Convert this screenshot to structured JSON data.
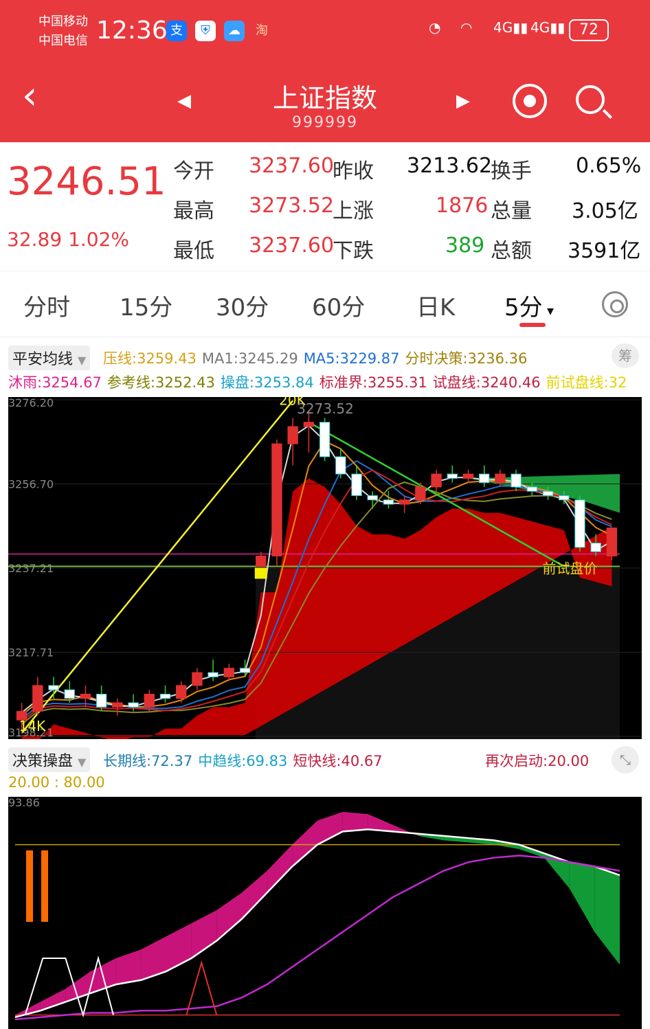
{
  "status_bar": {
    "carrier1": "中国移动",
    "carrier2": "中国电信",
    "time": "12:36",
    "app_icons": [
      "alipay-icon",
      "shield-icon",
      "weather-icon",
      "taobao-icon"
    ],
    "taobao_label": "淘",
    "alipay_label": "支",
    "signal_label": "4G",
    "battery": "72"
  },
  "header": {
    "title": "上证指数",
    "code": "999999"
  },
  "quote": {
    "price": "3246.51",
    "change": "32.89",
    "change_pct": "1.02%",
    "rows": [
      [
        {
          "label": "今开",
          "value": "3237.60"
        },
        {
          "label": "昨收",
          "value": "3213.62"
        },
        {
          "label": "换手",
          "value": "0.65%"
        }
      ],
      [
        {
          "label": "最高",
          "value": "3273.52"
        },
        {
          "label": "上涨",
          "value": "1876"
        },
        {
          "label": "总量",
          "value": "3.05亿"
        }
      ],
      [
        {
          "label": "最低",
          "value": "3237.60"
        },
        {
          "label": "下跌",
          "value": "389"
        },
        {
          "label": "总额",
          "value": "3591亿"
        }
      ]
    ]
  },
  "tabs": [
    "分时",
    "15分",
    "30分",
    "60分",
    "日K",
    "5分"
  ],
  "active_tab": "5分",
  "main_indicator": {
    "name": "平安均线",
    "line1": [
      {
        "label": "压线:",
        "value": "3259.43",
        "color": "#d4a017"
      },
      {
        "label": "MA1:",
        "value": "3245.29",
        "color": "#777777"
      },
      {
        "label": "MA5:",
        "value": "3229.87",
        "color": "#1f6fcf"
      },
      {
        "label": "分时决策:",
        "value": "3236.36",
        "color": "#a0820a"
      }
    ],
    "line2": [
      {
        "label": "沐雨:",
        "value": "3254.67",
        "color": "#e0208c"
      },
      {
        "label": "参考线:",
        "value": "3252.43",
        "color": "#808000"
      },
      {
        "label": "操盘:",
        "value": "3253.84",
        "color": "#1aa0c8"
      },
      {
        "label": "标准界:",
        "value": "3255.31",
        "color": "#c02040"
      },
      {
        "label": "试盘线:",
        "value": "3240.46",
        "color": "#c02040"
      },
      {
        "label": "前试盘线:",
        "value": "32",
        "color": "#e6d200"
      }
    ],
    "chip_label": "筹"
  },
  "sub_indicator": {
    "name": "决策操盘",
    "items": [
      {
        "label": "长期线:",
        "value": "72.37",
        "color": "#1f7fb0"
      },
      {
        "label": "中趋线:",
        "value": "69.83",
        "color": "#1aa0c8"
      },
      {
        "label": "短快线:",
        "value": "40.67",
        "color": "#c02040"
      }
    ],
    "restart": {
      "label": "再次启动:",
      "value": "20.00",
      "color": "#c02040"
    },
    "levels": "20.00 : 80.00",
    "levels_color": "#c8a000"
  },
  "chart_data": [
    {
      "type": "candlestick",
      "title": "",
      "y_ticks": [
        "3276.20",
        "3256.70",
        "3237.21",
        "3217.71",
        "3198.21"
      ],
      "ylim": [
        3198.21,
        3276.2
      ],
      "annotations": [
        "20K",
        "3273.52",
        "14K",
        "前试盘价"
      ],
      "candles": [
        {
          "o": 3202,
          "h": 3206,
          "l": 3199,
          "c": 3204
        },
        {
          "o": 3204,
          "h": 3212,
          "l": 3203,
          "c": 3210
        },
        {
          "o": 3210,
          "h": 3212,
          "l": 3207,
          "c": 3209
        },
        {
          "o": 3209,
          "h": 3211,
          "l": 3206,
          "c": 3207
        },
        {
          "o": 3207,
          "h": 3210,
          "l": 3205,
          "c": 3208
        },
        {
          "o": 3208,
          "h": 3210,
          "l": 3204,
          "c": 3205
        },
        {
          "o": 3205,
          "h": 3207,
          "l": 3203,
          "c": 3206
        },
        {
          "o": 3206,
          "h": 3208,
          "l": 3204,
          "c": 3205
        },
        {
          "o": 3205,
          "h": 3209,
          "l": 3204,
          "c": 3208
        },
        {
          "o": 3208,
          "h": 3210,
          "l": 3206,
          "c": 3207
        },
        {
          "o": 3207,
          "h": 3211,
          "l": 3206,
          "c": 3210
        },
        {
          "o": 3210,
          "h": 3214,
          "l": 3209,
          "c": 3213
        },
        {
          "o": 3213,
          "h": 3216,
          "l": 3211,
          "c": 3212
        },
        {
          "o": 3212,
          "h": 3215,
          "l": 3211,
          "c": 3214
        },
        {
          "o": 3214,
          "h": 3216,
          "l": 3212,
          "c": 3213
        },
        {
          "o": 3237.6,
          "h": 3241,
          "l": 3237.6,
          "c": 3240
        },
        {
          "o": 3240,
          "h": 3267,
          "l": 3237.6,
          "c": 3266
        },
        {
          "o": 3266,
          "h": 3272,
          "l": 3261,
          "c": 3270
        },
        {
          "o": 3270,
          "h": 3273.52,
          "l": 3264,
          "c": 3271
        },
        {
          "o": 3271,
          "h": 3272,
          "l": 3262,
          "c": 3263
        },
        {
          "o": 3263,
          "h": 3265,
          "l": 3258,
          "c": 3259
        },
        {
          "o": 3259,
          "h": 3261,
          "l": 3253,
          "c": 3254
        },
        {
          "o": 3254,
          "h": 3255,
          "l": 3251,
          "c": 3253
        },
        {
          "o": 3253,
          "h": 3255,
          "l": 3251,
          "c": 3252
        },
        {
          "o": 3252,
          "h": 3254,
          "l": 3250,
          "c": 3253
        },
        {
          "o": 3253,
          "h": 3257,
          "l": 3252,
          "c": 3256
        },
        {
          "o": 3256,
          "h": 3260,
          "l": 3255,
          "c": 3259
        },
        {
          "o": 3259,
          "h": 3261,
          "l": 3257,
          "c": 3258
        },
        {
          "o": 3258,
          "h": 3260,
          "l": 3257,
          "c": 3259
        },
        {
          "o": 3259,
          "h": 3261,
          "l": 3256,
          "c": 3257
        },
        {
          "o": 3257,
          "h": 3260,
          "l": 3256,
          "c": 3259
        },
        {
          "o": 3259,
          "h": 3260,
          "l": 3255,
          "c": 3256
        },
        {
          "o": 3256,
          "h": 3257,
          "l": 3254,
          "c": 3255
        },
        {
          "o": 3255,
          "h": 3256,
          "l": 3253,
          "c": 3254
        },
        {
          "o": 3254,
          "h": 3255,
          "l": 3252,
          "c": 3253
        },
        {
          "o": 3253,
          "h": 3254,
          "l": 3241,
          "c": 3242
        },
        {
          "o": 3243,
          "h": 3245,
          "l": 3240,
          "c": 3241
        },
        {
          "o": 3240,
          "h": 3246.51,
          "l": 3239,
          "c": 3246.51
        }
      ]
    },
    {
      "type": "line",
      "title": "",
      "y_ticks": [
        "93.86"
      ],
      "ylim": [
        0,
        100
      ],
      "series": [
        {
          "values": [
            2,
            8,
            14,
            22,
            28,
            32,
            38,
            44,
            50,
            58,
            68,
            80,
            91,
            95,
            94,
            89,
            84,
            82,
            81,
            80,
            78,
            74,
            60,
            40,
            25
          ]
        },
        {
          "values": [
            1,
            4,
            8,
            12,
            16,
            18,
            22,
            28,
            36,
            46,
            58,
            70,
            80,
            86,
            87,
            86,
            85,
            84,
            83,
            82,
            80,
            76,
            72,
            70,
            66
          ]
        },
        {
          "values": [
            0,
            1,
            2,
            3,
            3,
            4,
            4,
            5,
            6,
            10,
            16,
            24,
            32,
            40,
            48,
            56,
            62,
            68,
            72,
            74,
            75,
            74,
            72,
            70,
            68
          ]
        }
      ]
    }
  ]
}
